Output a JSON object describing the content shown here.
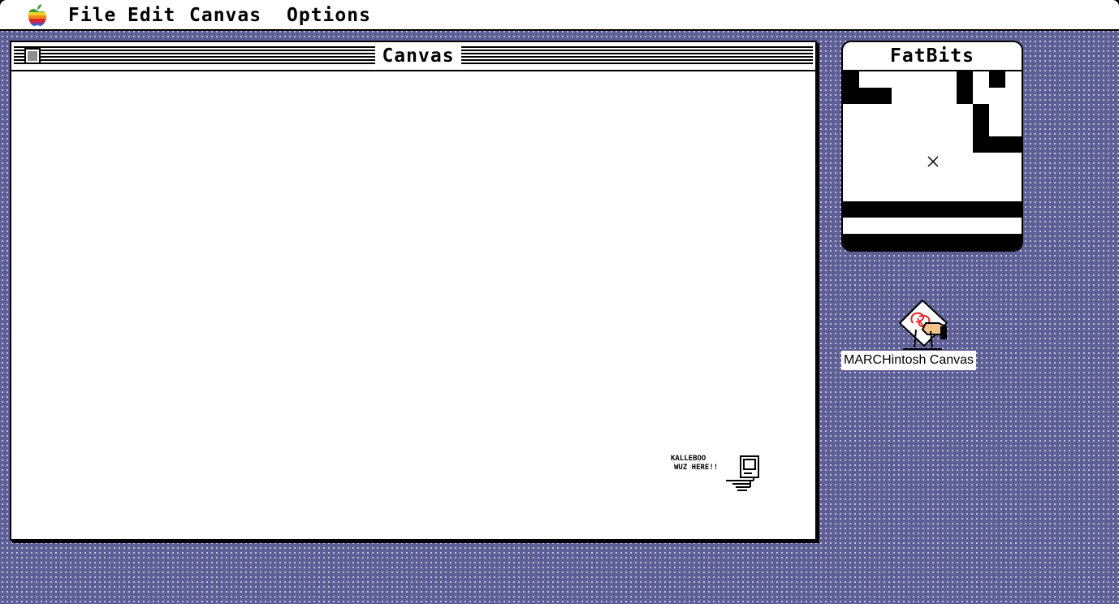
{
  "menubar": {
    "apple_icon": "apple-rainbow-icon",
    "items": [
      "File",
      "Edit",
      "Canvas",
      "Options"
    ]
  },
  "window": {
    "title": "Canvas",
    "close_icon": "close-box-icon",
    "signature": {
      "line1": "KALLEBOO",
      "line2": "WUZ HERE!!"
    }
  },
  "fatbits": {
    "title": "FatBits",
    "cursor_icon": "crosshair-icon"
  },
  "desktop_icon": {
    "label": "MARCHintosh Canvas",
    "icon": "canvas-app-icon"
  },
  "colors": {
    "desktop": "#5e5f94",
    "dots": "#c9cae6",
    "sketch": "#e0282a"
  }
}
